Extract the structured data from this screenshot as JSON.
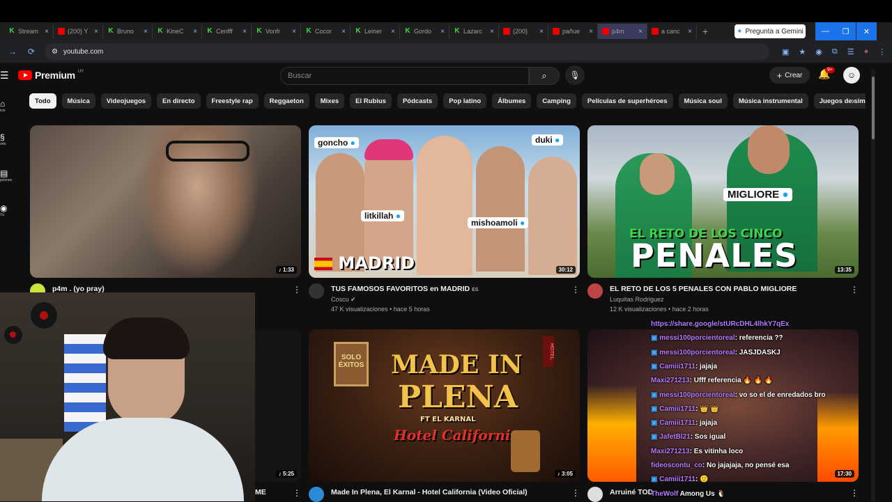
{
  "browser": {
    "tabs": [
      {
        "label": "Stream",
        "icon": "kick"
      },
      {
        "label": "(200) Y",
        "icon": "youtube"
      },
      {
        "label": "Bruno",
        "icon": "kick"
      },
      {
        "label": "KineC",
        "icon": "kick"
      },
      {
        "label": "Cenfff",
        "icon": "kick"
      },
      {
        "label": "Vonfr",
        "icon": "kick"
      },
      {
        "label": "Cocor",
        "icon": "kick"
      },
      {
        "label": "Leiner",
        "icon": "kick"
      },
      {
        "label": "Gordo",
        "icon": "kick"
      },
      {
        "label": "Lazarc",
        "icon": "kick"
      },
      {
        "label": "(200)",
        "icon": "youtube"
      },
      {
        "label": "pañue",
        "icon": "youtube"
      },
      {
        "label": "p4m",
        "icon": "youtube"
      },
      {
        "label": "a canc",
        "icon": "youtube"
      }
    ],
    "gemini_label": "Pregunta a Gemini",
    "url": "youtube.com"
  },
  "youtube": {
    "logo_text": "Premium",
    "country": "UY",
    "search_placeholder": "Buscar",
    "create_label": "Crear",
    "notif_count": "9+",
    "sidebar": [
      {
        "label": "icio",
        "icon": "home-icon"
      },
      {
        "label": "orts",
        "icon": "shorts-icon"
      },
      {
        "label": "pciones",
        "icon": "subscriptions-icon"
      },
      {
        "label": "Tú",
        "icon": "you-icon"
      }
    ],
    "chips": [
      "Todo",
      "Música",
      "Videojuegos",
      "En directo",
      "Freestyle rap",
      "Reggaeton",
      "Mixes",
      "El Rubius",
      "Pódcasts",
      "Pop latino",
      "Álbumes",
      "Camping",
      "Películas de superhéroes",
      "Música soul",
      "Música instrumental",
      "Juegos de simulación de"
    ],
    "videos": [
      {
        "title": "p4m .          (yo    pray)",
        "channel": "",
        "stats": "",
        "duration": "1:33"
      },
      {
        "title": "TUS FAMOSOS FAVORITOS en MADRID",
        "tag": "ES",
        "channel": "Coscu",
        "stats": "47 K visualizaciones • hace 5 horas",
        "duration": "30:12",
        "overlay": "MADRID",
        "names": [
          "goncho",
          "duki",
          "litkillah",
          "mishoamoli"
        ]
      },
      {
        "title": "EL RETO DE LOS 5 PENALES CON PABLO MIGLIORE",
        "channel": "Luquitas Rodriguez",
        "stats": "12 K visualizaciones • hace 2 horas",
        "duration": "13:35",
        "overlay_top": "EL RETO DE LOS CINCO",
        "overlay": "PENALES",
        "name": "MIGLIORE"
      },
      {
        "title": "ME",
        "channel": "",
        "stats": "",
        "duration": "5:25"
      },
      {
        "title": "Made In Plena, El Karnal - Hotel California (Video Oficial)",
        "channel": "",
        "stats": "",
        "duration": "3:05",
        "overlay1": "MADE IN",
        "overlay2": "PLENA",
        "overlay3": "FT EL KARNAL",
        "overlay4": "Hotel California",
        "sign": "SOLO ÉXITOS",
        "hotel": "HOTEL"
      },
      {
        "title": "Arruiné TOD",
        "channel": "",
        "stats": "",
        "duration": "17:30"
      }
    ]
  },
  "chat": [
    {
      "user": "",
      "msg": "https://share.google/stURcDHL4lhkY7qEx",
      "link": true
    },
    {
      "user": "messi100porcientoreal",
      "msg": ": referencia ??"
    },
    {
      "user": "messi100porcientoreal",
      "msg": ": JASJDASKJ"
    },
    {
      "user": "Camiii1711",
      "msg": ": jajaja"
    },
    {
      "user": "Maxi271213",
      "msg": ": Ufff referencia 🔥 🔥 🔥"
    },
    {
      "user": "messi100porcientoreal",
      "msg": ": vo so el de enredados bro"
    },
    {
      "user": "Camiii1711",
      "msg": ": 👑 👑"
    },
    {
      "user": "Camiii1711",
      "msg": ": jajaja"
    },
    {
      "user": "JafetBl21",
      "msg": ": Sos igual"
    },
    {
      "user": "Maxi271213",
      "msg": ": Es vitinha loco"
    },
    {
      "user": "fideoscontu_co",
      "msg": ": No jajajaja, no pensé esa"
    },
    {
      "user": "Camiii1711",
      "msg": ": 🙂"
    },
    {
      "user": "TheWolf",
      "msg": " Among Us 🐧"
    }
  ]
}
